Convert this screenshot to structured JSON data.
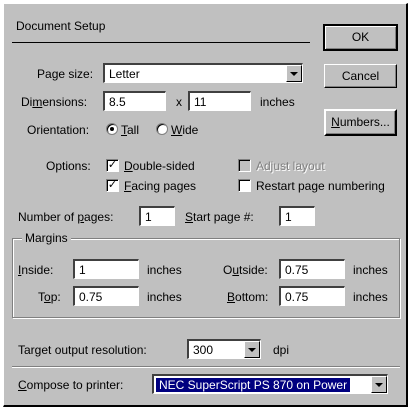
{
  "title": "Document Setup",
  "buttons": {
    "ok": "OK",
    "cancel": "Cancel",
    "numbers": "Numbers..."
  },
  "page_size": {
    "label": "Page size:",
    "value": "Letter"
  },
  "dimensions": {
    "label": "Dimensions:",
    "width": "8.5",
    "x": "x",
    "height": "11",
    "unit": "inches"
  },
  "orientation": {
    "label": "Orientation:",
    "tall": "Tall",
    "wide": "Wide",
    "selected": "Tall"
  },
  "options": {
    "label": "Options:",
    "double_sided": {
      "label": "Double-sided",
      "checked": true
    },
    "facing_pages": {
      "label": "Facing pages",
      "checked": true
    },
    "adjust_layout": {
      "label": "Adjust layout",
      "checked": false,
      "enabled": false
    },
    "restart_numbering": {
      "label": "Restart page numbering",
      "checked": false
    }
  },
  "number_of_pages": {
    "label": "Number of pages:",
    "value": "1"
  },
  "start_page": {
    "label": "Start page #:",
    "value": "1"
  },
  "margins": {
    "label": "Margins",
    "inside": {
      "label": "Inside:",
      "value": "1",
      "unit": "inches"
    },
    "outside": {
      "label": "Outside:",
      "value": "0.75",
      "unit": "inches"
    },
    "top": {
      "label": "Top:",
      "value": "0.75",
      "unit": "inches"
    },
    "bottom": {
      "label": "Bottom:",
      "value": "0.75",
      "unit": "inches"
    }
  },
  "resolution": {
    "label": "Target output resolution:",
    "value": "300",
    "unit": "dpi"
  },
  "printer": {
    "label": "Compose to printer:",
    "value": "NEC SuperScript PS 870 on Power"
  },
  "colors": {
    "face": "#c0c0c0",
    "highlight": "#000080"
  }
}
